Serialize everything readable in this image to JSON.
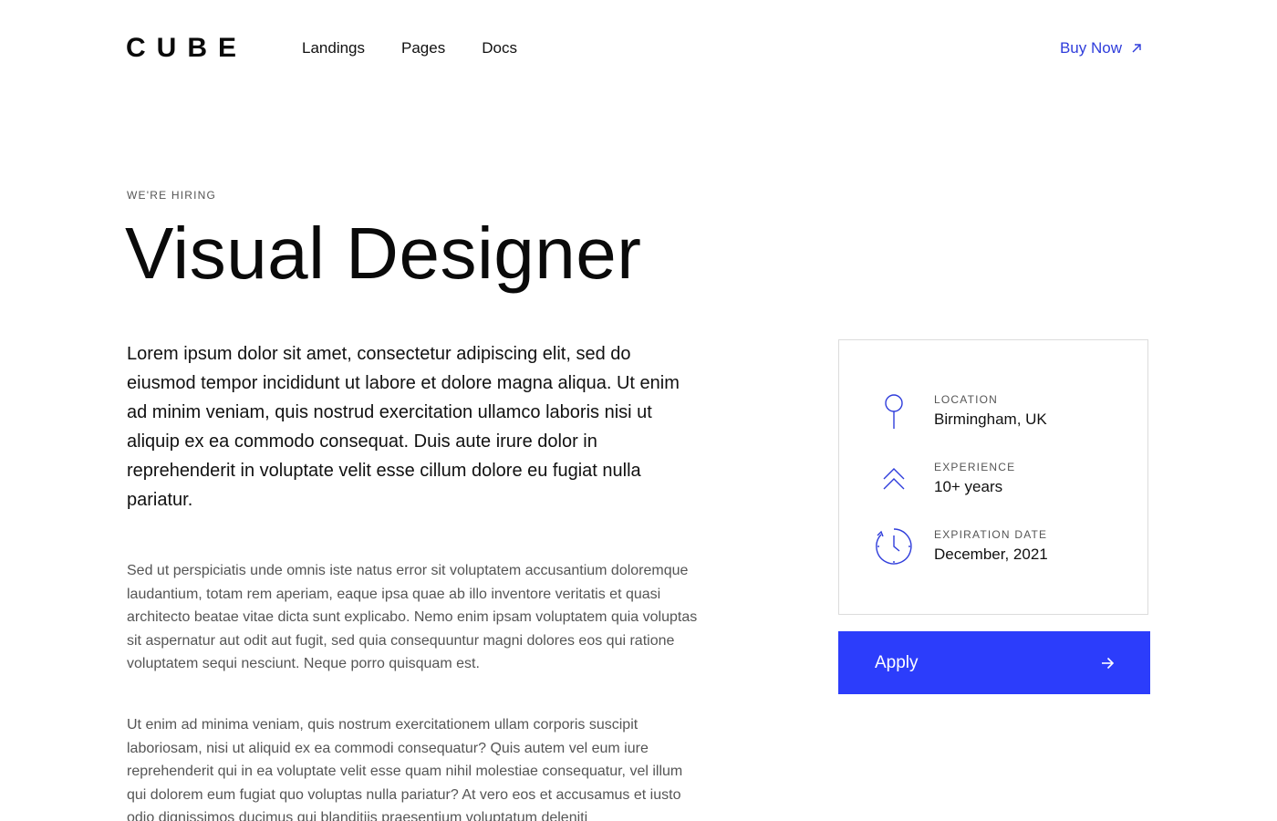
{
  "header": {
    "logo": "CUBE",
    "nav": [
      "Landings",
      "Pages",
      "Docs"
    ],
    "buy_now_label": "Buy Now"
  },
  "hero": {
    "eyebrow": "WE'RE HIRING",
    "title": "Visual Designer"
  },
  "content": {
    "lead": "Lorem ipsum dolor sit amet, consectetur adipiscing elit, sed do eiusmod tempor incididunt ut labore et dolore magna aliqua. Ut enim ad minim veniam, quis nostrud exercitation ullamco laboris nisi ut aliquip ex ea commodo consequat. Duis aute irure dolor in reprehenderit in voluptate velit esse cillum dolore eu fugiat nulla pariatur.",
    "paragraph_1": "Sed ut perspiciatis unde omnis iste natus error sit voluptatem accusantium doloremque laudantium, totam rem aperiam, eaque ipsa quae ab illo inventore veritatis et quasi architecto beatae vitae dicta sunt explicabo. Nemo enim ipsam voluptatem quia voluptas sit aspernatur aut odit aut fugit, sed quia consequuntur magni dolores eos qui ratione voluptatem sequi nesciunt. Neque porro quisquam est.",
    "paragraph_2": "Ut enim ad minima veniam, quis nostrum exercitationem ullam corporis suscipit laboriosam, nisi ut aliquid ex ea commodi consequatur? Quis autem vel eum iure reprehenderit qui in ea voluptate velit esse quam nihil molestiae consequatur, vel illum qui dolorem eum fugiat quo voluptas nulla pariatur? At vero eos et accusamus et iusto odio dignissimos ducimus qui blanditiis praesentium voluptatum deleniti"
  },
  "card": {
    "items": [
      {
        "icon": "location-pin-icon",
        "label": "LOCATION",
        "value": "Birmingham, UK"
      },
      {
        "icon": "double-chevron-up-icon",
        "label": "EXPERIENCE",
        "value": "10+ years"
      },
      {
        "icon": "clock-icon",
        "label": "EXPIRATION DATE",
        "value": "December, 2021"
      }
    ]
  },
  "apply": {
    "label": "Apply"
  },
  "colors": {
    "accent": "#2c3dfb",
    "link": "#2f3ddb",
    "text": "#111111",
    "muted": "#555555",
    "border": "#dcdcdc"
  }
}
